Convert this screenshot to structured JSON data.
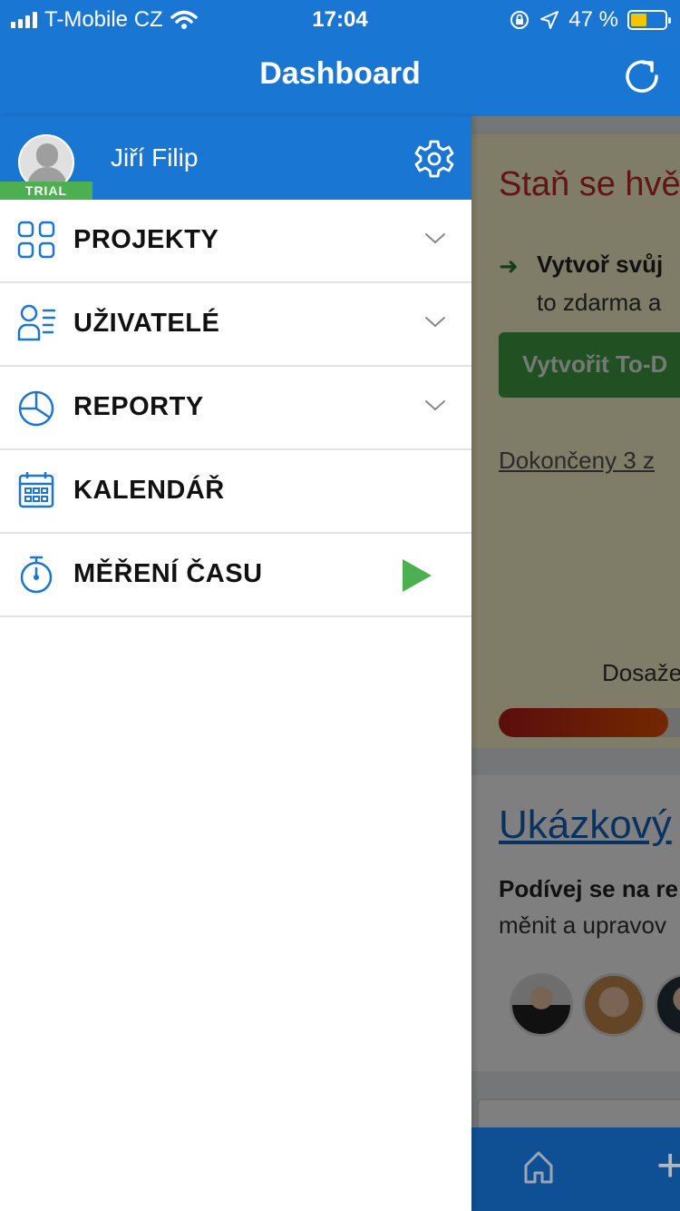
{
  "status_bar": {
    "carrier": "T-Mobile CZ",
    "time": "17:04",
    "battery_percent": "47 %",
    "battery_level": 0.47
  },
  "header": {
    "title": "Dashboard"
  },
  "drawer": {
    "user_name": "Jiří Filip",
    "trial_badge": "TRIAL",
    "menu": [
      {
        "label": "PROJEKTY",
        "icon": "grid-icon",
        "expandable": true
      },
      {
        "label": "UŽIVATELÉ",
        "icon": "users-icon",
        "expandable": true
      },
      {
        "label": "REPORTY",
        "icon": "pie-chart-icon",
        "expandable": true
      },
      {
        "label": "KALENDÁŘ",
        "icon": "calendar-icon",
        "expandable": false
      },
      {
        "label": "MĚŘENÍ ČASU",
        "icon": "stopwatch-icon",
        "expandable": false,
        "action": "play-icon"
      }
    ]
  },
  "background": {
    "card1": {
      "title": "Staň se hvě",
      "line1": "Vytvoř svůj",
      "line2": "to zdarma a",
      "button": "Vytvořit To-D",
      "done_link": "Dokončeny 3 z",
      "achieved": "Dosaže",
      "progress": 0.85
    },
    "card2": {
      "title": "Ukázkový",
      "bold_text": "Podívej se na re",
      "text": "měnit a upravov"
    }
  },
  "colors": {
    "primary": "#1976d2",
    "trial": "#4caf50",
    "play": "#4caf50",
    "icon": "#1976d2"
  }
}
